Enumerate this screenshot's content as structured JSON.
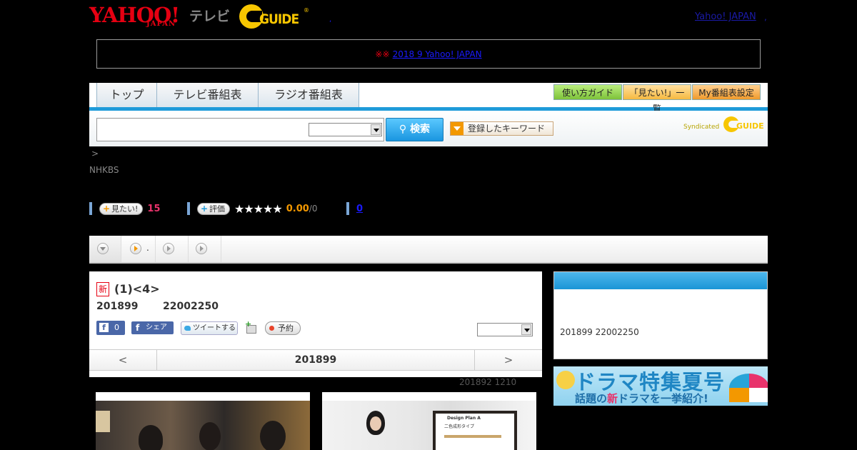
{
  "header": {
    "logo_yahoo": "YAHOO!",
    "logo_japan": "JAPAN",
    "logo_tv": "テレビ",
    "logo_gguide": "GUIDE",
    "logo_registered": "®",
    "separator": ",",
    "yahoo_japan_link": "Yahoo! JAPAN",
    "yahoo_japan_dot": ","
  },
  "notice": {
    "mark": "※※",
    "link": "2018 9 Yahoo! JAPAN"
  },
  "nav": {
    "tabs": [
      "トップ",
      "テレビ番組表",
      "ラジオ番組表"
    ],
    "buttons": [
      "使い方ガイド",
      "「見たい!」一覧",
      "My番組表設定"
    ]
  },
  "search": {
    "button": "検索",
    "keyword_button": "登録したキーワード",
    "syndicated": "Syndicated",
    "gguide": "GUIDE"
  },
  "breadcrumb": ">",
  "channel": "NHKBS",
  "stats": {
    "want_label": "見たい!",
    "want_count": "15",
    "rate_label": "評価",
    "stars": "★★★★★",
    "score": "0.00",
    "score_max": "/0",
    "comment_count": "0"
  },
  "subtabs": {
    "play_label": "."
  },
  "program": {
    "new_badge": "新",
    "title": "(1)<4>",
    "date": "201899",
    "time": "22002250",
    "like_count": "0",
    "like_f": "f",
    "share_label": "シェア",
    "tweet_label": "ツイートする",
    "reserve_label": "予約",
    "pager_prev": "<",
    "pager_next": ">",
    "pager_label": "201899"
  },
  "updated": "201892  1210",
  "side": {
    "text": "201899  22002250"
  },
  "banner": {
    "title": "ドラマ特集夏号",
    "sub_before": "話題の",
    "sub_red": "新",
    "sub_after": "ドラマを一挙紹介!"
  },
  "photo2": {
    "board_title": "Design Plan A",
    "board_sub": "二色成形タイプ"
  },
  "colors": {
    "yahoo_red": "#e60012",
    "gguide_yellow": "#f7c600",
    "nav_blue": "#1f9bd9",
    "accent_pink": "#e8336b",
    "accent_orange": "#f39800"
  }
}
